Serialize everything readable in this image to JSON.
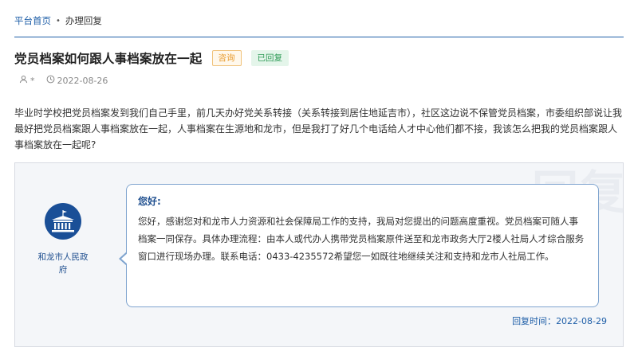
{
  "breadcrumb": {
    "home": "平台首页",
    "separator": "•",
    "current": "办理回复"
  },
  "question": {
    "title": "党员档案如何跟人事档案放在一起",
    "tags": {
      "type": "咨询",
      "status": "已回复"
    },
    "author": "*",
    "date": "2022-08-26",
    "body": "毕业时学校把党员档案发到我们自己手里，前几天办好党关系转接（关系转接到居住地延吉市），社区这边说不保管党员档案，市委组织部说让我最好把党员档案跟人事档案放在一起，人事档案在生源地和龙市，但是我打了好几个电话给人才中心他们都不接，我该怎么把我的党员档案跟人事档案放在一起呢?"
  },
  "reply": {
    "watermark": "回复",
    "org_name": "和龙市人民政府",
    "greeting": "您好:",
    "text": "您好，感谢您对和龙市人力资源和社会保障局工作的支持，我局对您提出的问题高度重视。党员档案可随人事档案一同保存。具体办理流程：由本人或代办人携带党员档案原件送至和龙市政务大厅2楼人社局人才综合服务窗口进行现场办理。联系电话：0433-4235572希望您一如既往地继续关注和支持和龙市人社局工作。",
    "time_label": "回复时间：",
    "time": "2022-08-29"
  },
  "colors": {
    "brand": "#1f5fa8",
    "consult": "#e89a2c",
    "replied": "#2f9b57"
  },
  "icons": {
    "author": "user-icon",
    "date": "clock-icon",
    "org": "government-building-icon"
  }
}
